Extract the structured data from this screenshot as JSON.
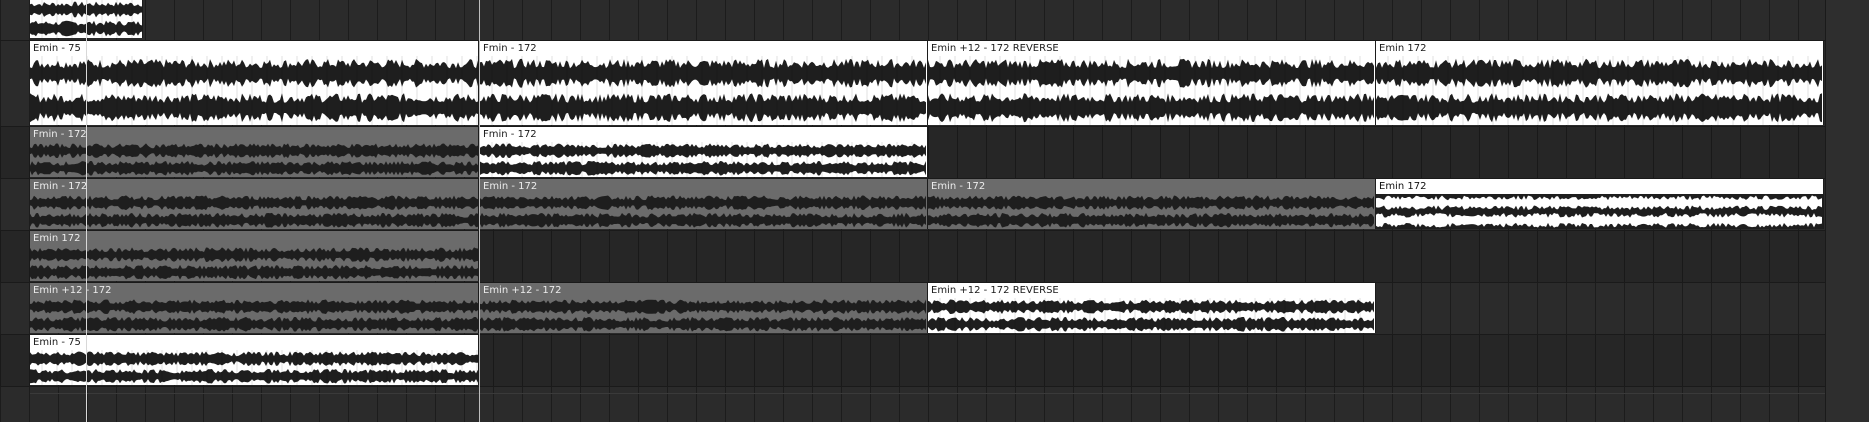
{
  "colors": {
    "background": "#2a2a2a",
    "clip_active": "#ffffff",
    "clip_inactive": "#6b6b6b",
    "waveform": "#1e1e1e"
  },
  "tracks": [
    {
      "name_visible": false,
      "clips": [
        {
          "label": "",
          "state": "active",
          "icon": "waveform"
        }
      ]
    },
    {
      "clips": [
        {
          "label": "Emin - 75",
          "state": "active"
        },
        {
          "label": "Fmin - 172",
          "state": "active"
        },
        {
          "label": "Emin +12 - 172 REVERSE",
          "state": "active"
        },
        {
          "label": "Emin 172",
          "state": "active"
        }
      ]
    },
    {
      "clips": [
        {
          "label": "Fmin - 172",
          "state": "inactive"
        },
        {
          "label": "Fmin - 172",
          "state": "active"
        }
      ]
    },
    {
      "clips": [
        {
          "label": "Emin - 172",
          "state": "inactive"
        },
        {
          "label": "Emin - 172",
          "state": "inactive"
        },
        {
          "label": "Emin - 172",
          "state": "inactive"
        },
        {
          "label": "Emin 172",
          "state": "active"
        }
      ]
    },
    {
      "clips": [
        {
          "label": "Emin 172",
          "state": "inactive"
        }
      ]
    },
    {
      "clips": [
        {
          "label": "Emin +12 - 172",
          "state": "inactive"
        },
        {
          "label": "Emin +12 - 172",
          "state": "inactive"
        },
        {
          "label": "Emin +12 - 172 REVERSE",
          "state": "active"
        }
      ]
    },
    {
      "clips": [
        {
          "label": "Emin - 75",
          "state": "active"
        }
      ]
    }
  ]
}
